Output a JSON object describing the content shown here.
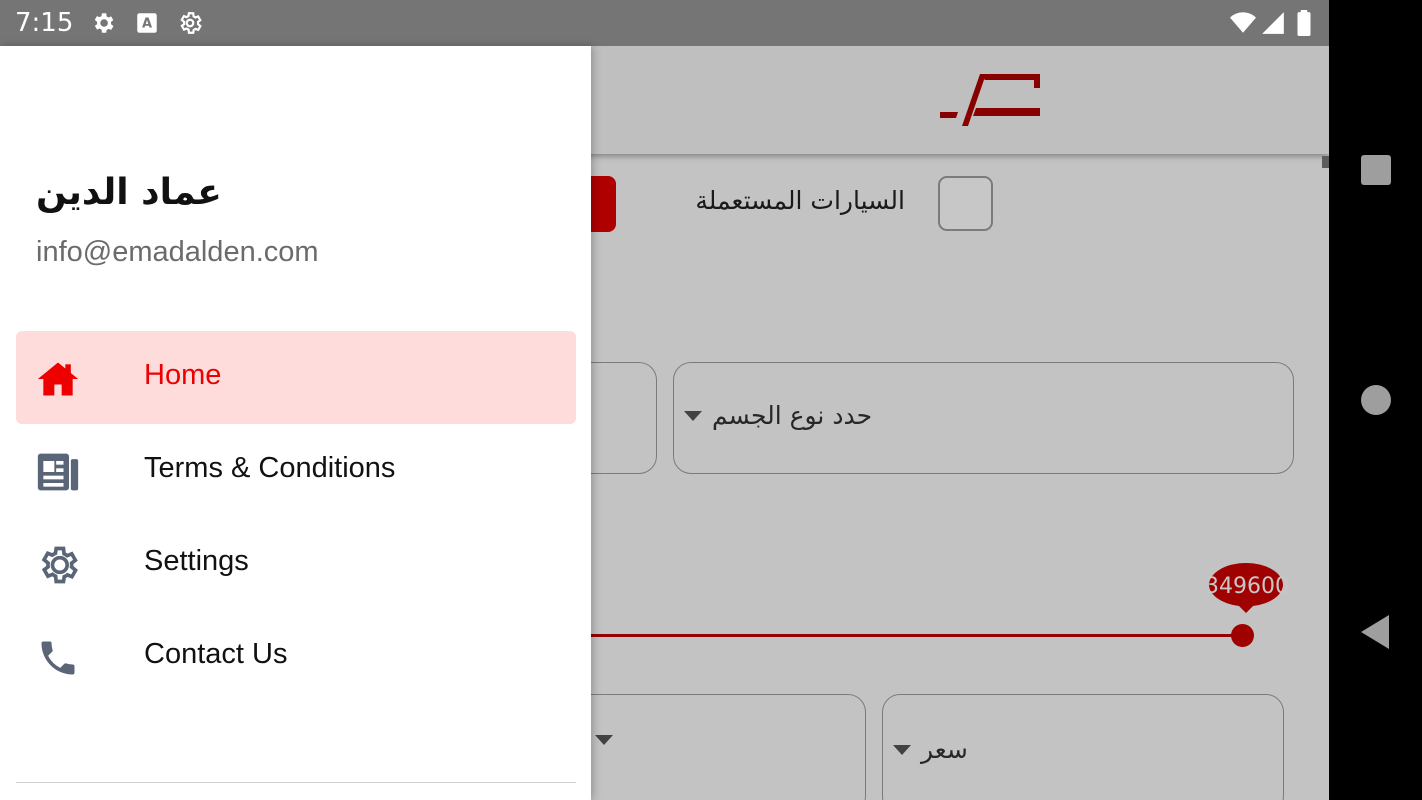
{
  "status_bar": {
    "time": "7:15"
  },
  "drawer": {
    "user_name": "عماد الدين",
    "user_email": "info@emadalden.com",
    "items": [
      {
        "label": "Home",
        "icon": "home-icon",
        "active": true
      },
      {
        "label": "Terms & Conditions",
        "icon": "document-icon",
        "active": false
      },
      {
        "label": "Settings",
        "icon": "gear-icon",
        "active": false
      },
      {
        "label": "Contact Us",
        "icon": "phone-icon",
        "active": false
      }
    ]
  },
  "background": {
    "used_cars_label": "السيارات المستعملة",
    "body_type_placeholder": "حدد نوع الجسم",
    "price_slider_value": "349600",
    "price_dropdown": "سعر"
  },
  "colors": {
    "accent": "#ee0000",
    "active_bg": "#ffdcdc",
    "logo": "#b00000"
  }
}
